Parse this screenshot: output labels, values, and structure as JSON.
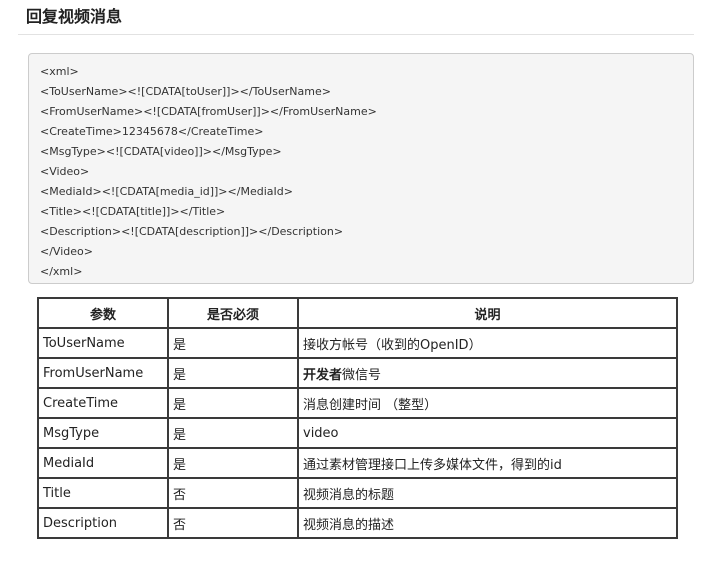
{
  "page_title": "回复视频消息",
  "code_lines": [
    "<xml>",
    "<ToUserName><![CDATA[toUser]]></ToUserName>",
    "<FromUserName><![CDATA[fromUser]]></FromUserName>",
    "<CreateTime>12345678</CreateTime>",
    "<MsgType><![CDATA[video]]></MsgType>",
    "<Video>",
    "<MediaId><![CDATA[media_id]]></MediaId>",
    "<Title><![CDATA[title]]></Title>",
    "<Description><![CDATA[description]]></Description>",
    "</Video>",
    "</xml>"
  ],
  "table": {
    "headers": [
      "参数",
      "是否必须",
      "说明"
    ],
    "rows": [
      {
        "param": "ToUserName",
        "required": "是",
        "desc": "接收方帐号（收到的OpenID）",
        "desc_bold": ""
      },
      {
        "param": "FromUserName",
        "required": "是",
        "desc": "微信号",
        "desc_bold": "开发者"
      },
      {
        "param": "CreateTime",
        "required": "是",
        "desc": "消息创建时间 （整型）",
        "desc_bold": ""
      },
      {
        "param": "MsgType",
        "required": "是",
        "desc": "video",
        "desc_bold": ""
      },
      {
        "param": "MediaId",
        "required": "是",
        "desc": "通过素材管理接口上传多媒体文件，得到的id",
        "desc_bold": ""
      },
      {
        "param": "Title",
        "required": "否",
        "desc": "视频消息的标题",
        "desc_bold": ""
      },
      {
        "param": "Description",
        "required": "否",
        "desc": "视频消息的描述",
        "desc_bold": ""
      }
    ]
  }
}
